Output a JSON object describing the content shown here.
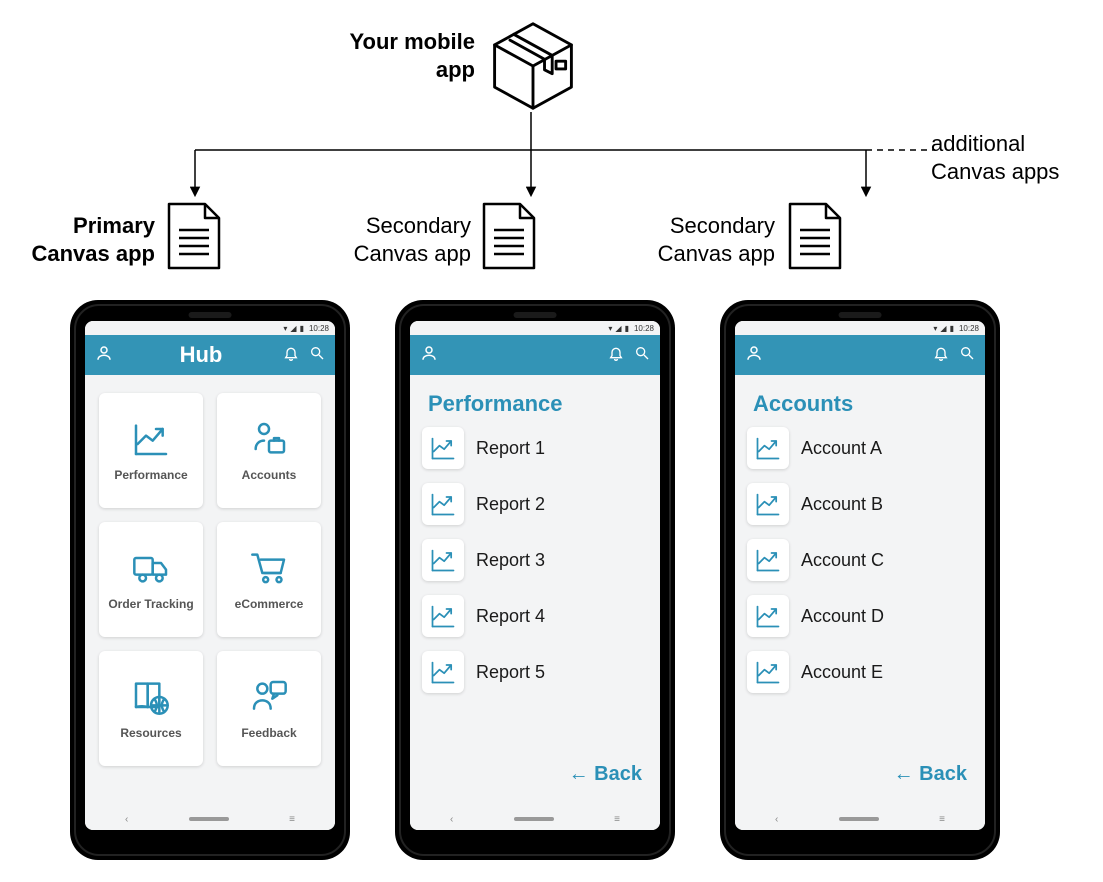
{
  "header": {
    "main_label": "Your mobile\napp",
    "additional_label": "additional\nCanvas apps"
  },
  "branches": [
    {
      "label": "Primary\nCanvas app",
      "bold": true
    },
    {
      "label": "Secondary\nCanvas app",
      "bold": false
    },
    {
      "label": "Secondary\nCanvas app",
      "bold": false
    }
  ],
  "status": {
    "time": "10:28"
  },
  "colors": {
    "accent": "#2b90b7",
    "appbar": "#3394b6"
  },
  "phones": {
    "hub": {
      "title": "Hub",
      "tiles": [
        {
          "label": "Performance",
          "icon": "chart"
        },
        {
          "label": "Accounts",
          "icon": "person-briefcase"
        },
        {
          "label": "Order Tracking",
          "icon": "truck"
        },
        {
          "label": "eCommerce",
          "icon": "cart"
        },
        {
          "label": "Resources",
          "icon": "book-globe"
        },
        {
          "label": "Feedback",
          "icon": "person-chat"
        }
      ]
    },
    "performance": {
      "title": "Performance",
      "items": [
        "Report 1",
        "Report 2",
        "Report 3",
        "Report 4",
        "Report 5"
      ],
      "back": "← Back"
    },
    "accounts": {
      "title": "Accounts",
      "items": [
        "Account A",
        "Account B",
        "Account C",
        "Account D",
        "Account E"
      ],
      "back": "← Back"
    }
  }
}
